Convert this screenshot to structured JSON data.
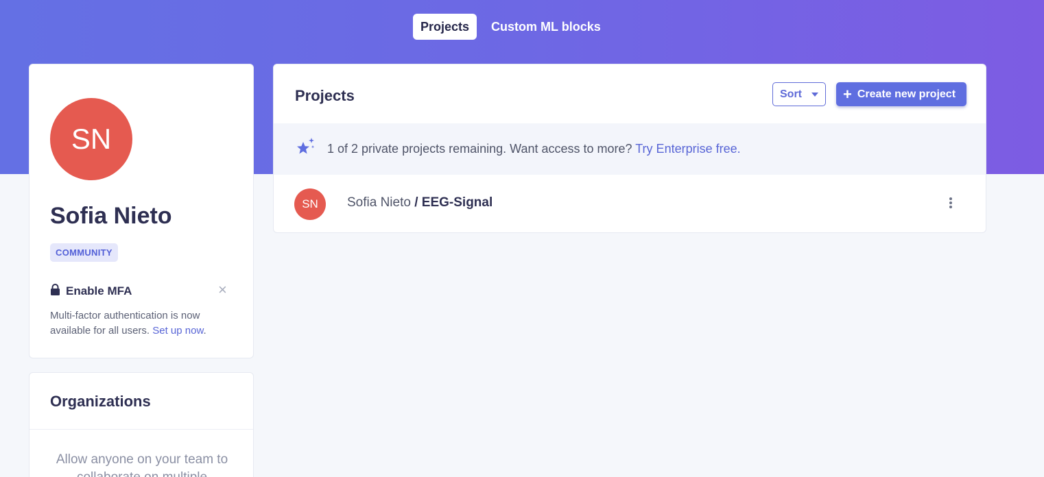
{
  "nav": {
    "tabs": [
      {
        "label": "Projects",
        "active": true
      },
      {
        "label": "Custom ML blocks",
        "active": false
      }
    ]
  },
  "profile": {
    "initials": "SN",
    "name": "Sofia Nieto",
    "plan_badge": "COMMUNITY",
    "mfa": {
      "title": "Enable MFA",
      "text": "Multi-factor authentication is now available for all users.",
      "link": "Set up now",
      "link_suffix": "."
    }
  },
  "organizations": {
    "title": "Organizations",
    "text": "Allow anyone on your team to collaborate on multiple"
  },
  "projects": {
    "title": "Projects",
    "sort_label": "Sort",
    "create_label": "Create new project",
    "promo": {
      "text": "1 of 2 private projects remaining. Want access to more?",
      "link": "Try Enterprise free."
    },
    "items": [
      {
        "initials": "SN",
        "owner": "Sofia Nieto",
        "separator": " / ",
        "name": "EEG-Signal"
      }
    ]
  },
  "colors": {
    "brand": "#5f6ee0",
    "avatar": "#e55a50",
    "gradient_start": "#6470e4",
    "gradient_end": "#7d5ce3"
  }
}
